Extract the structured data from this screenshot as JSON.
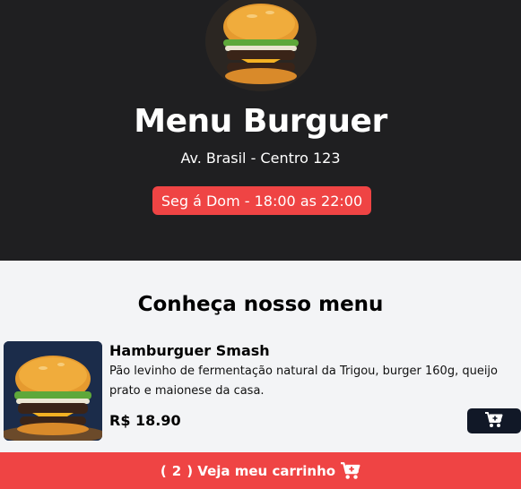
{
  "hero": {
    "title": "Menu Burguer",
    "address": "Av. Brasil - Centro 123",
    "hours": "Seg á Dom - 18:00 as 22:00"
  },
  "menu": {
    "heading": "Conheça nosso menu",
    "items": [
      {
        "name": "Hamburguer Smash",
        "description": "Pão levinho de fermentação natural da Trigou, burger 160g, queijo prato e maionese da casa.",
        "price": "R$ 18.90"
      }
    ]
  },
  "cart": {
    "open_paren": "(",
    "count": "2",
    "label": ") Veja meu carrinho"
  },
  "icons": {
    "add_to_cart": "cart-plus-icon",
    "cart": "cart-plus-icon"
  },
  "colors": {
    "hero_bg": "#1f1f21",
    "accent": "#ef4444",
    "button_dark": "#111827",
    "page_bg": "#f3f4f6"
  }
}
